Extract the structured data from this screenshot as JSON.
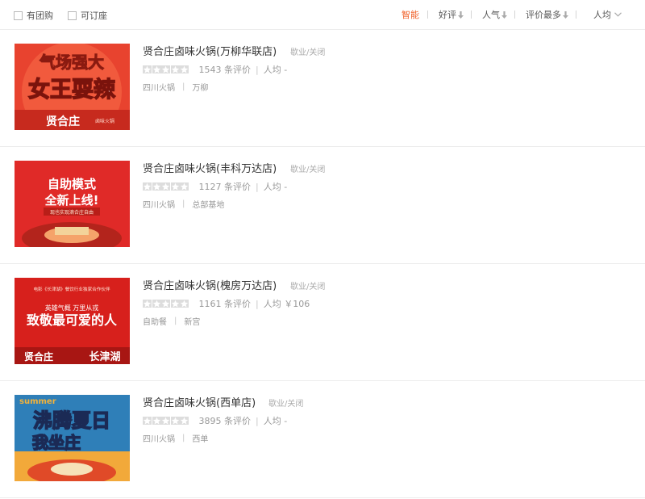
{
  "filters": {
    "group_buy": "有团购",
    "reservable": "可订座"
  },
  "sort": {
    "smart": "智能",
    "good_review": "好评",
    "popularity": "人气",
    "most_reviews": "评价最多",
    "avg_price": "人均"
  },
  "colors": {
    "accent": "#f0612a",
    "star_empty": "#dddddd"
  },
  "shops": [
    {
      "name": "贤合庄卤味火锅(万柳华联店)",
      "status": "歇业/关闭",
      "stars": 0,
      "reviews": "1543 条评价",
      "avg": "人均 -",
      "cuisine": "四川火锅",
      "area": "万柳",
      "image": {
        "line1": "气场强大",
        "line2": "女王耍辣",
        "brand": "贤合庄",
        "brand_sub": "卤味火锅"
      }
    },
    {
      "name": "贤合庄卤味火锅(丰科万达店)",
      "status": "歇业/关闭",
      "stars": 0,
      "reviews": "1127 条评价",
      "avg": "人均 -",
      "cuisine": "四川火锅",
      "area": "总部基地",
      "image": {
        "line1": "自助模式",
        "line2": "全新上线!",
        "sub": "现也实现滴合庄自由"
      }
    },
    {
      "name": "贤合庄卤味火锅(槐房万达店)",
      "status": "歇业/关闭",
      "stars": 0,
      "reviews": "1161 条评价",
      "avg": "人均 ￥106",
      "cuisine": "自助餐",
      "area": "新宫",
      "image": {
        "top": "电影《长津湖》餐饮行业独家合作伙伴",
        "mid": "英雄气概 万里从戎",
        "big": "致敬最可爱的人",
        "brand": "贤合庄",
        "movie": "长津湖"
      }
    },
    {
      "name": "贤合庄卤味火锅(西单店)",
      "status": "歇业/关闭",
      "stars": 0,
      "reviews": "3895 条评价",
      "avg": "人均 -",
      "cuisine": "四川火锅",
      "area": "西单",
      "image": {
        "tag": "summer",
        "line1": "沸腾夏日",
        "line2": "我坐庄"
      }
    }
  ]
}
